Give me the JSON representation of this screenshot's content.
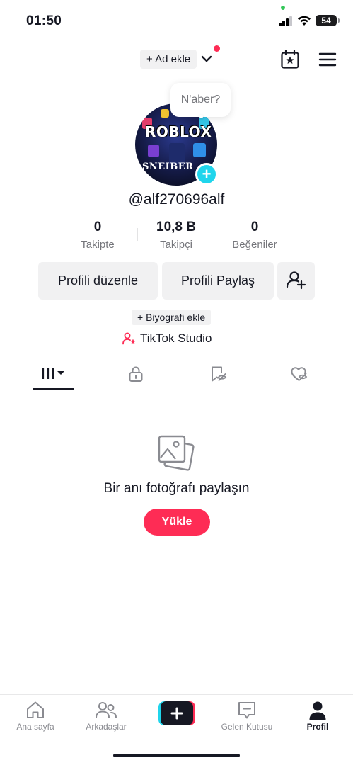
{
  "status_bar": {
    "time": "01:50",
    "battery": "54"
  },
  "header": {
    "add_name": "+ Ad ekle"
  },
  "bubble": {
    "text": "N'aber?"
  },
  "avatar": {
    "brand_text": "ROBLOX",
    "tag_text": "SNEIBER"
  },
  "profile": {
    "username": "@alf270696alf"
  },
  "stats": [
    {
      "value": "0",
      "label": "Takipte"
    },
    {
      "value": "10,8 B",
      "label": "Takipçi"
    },
    {
      "value": "0",
      "label": "Beğeniler"
    }
  ],
  "actions": {
    "edit_profile": "Profili düzenle",
    "share_profile": "Profili Paylaş"
  },
  "bio": {
    "add_bio": "+ Biyografi ekle",
    "studio": "TikTok Studio"
  },
  "empty_state": {
    "title": "Bir anı fotoğrafı paylaşın",
    "upload": "Yükle"
  },
  "bottom_nav": [
    {
      "label": "Ana sayfa",
      "icon": "home-icon"
    },
    {
      "label": "Arkadaşlar",
      "icon": "friends-icon"
    },
    {
      "label": "",
      "icon": "create-plus-icon"
    },
    {
      "label": "Gelen Kutusu",
      "icon": "inbox-icon"
    },
    {
      "label": "Profil",
      "icon": "profile-icon"
    }
  ],
  "colors": {
    "accent": "#fe2c55",
    "cyan": "#20d5ec",
    "text": "#161823",
    "muted": "#75767b",
    "chip": "#f1f1f2"
  }
}
